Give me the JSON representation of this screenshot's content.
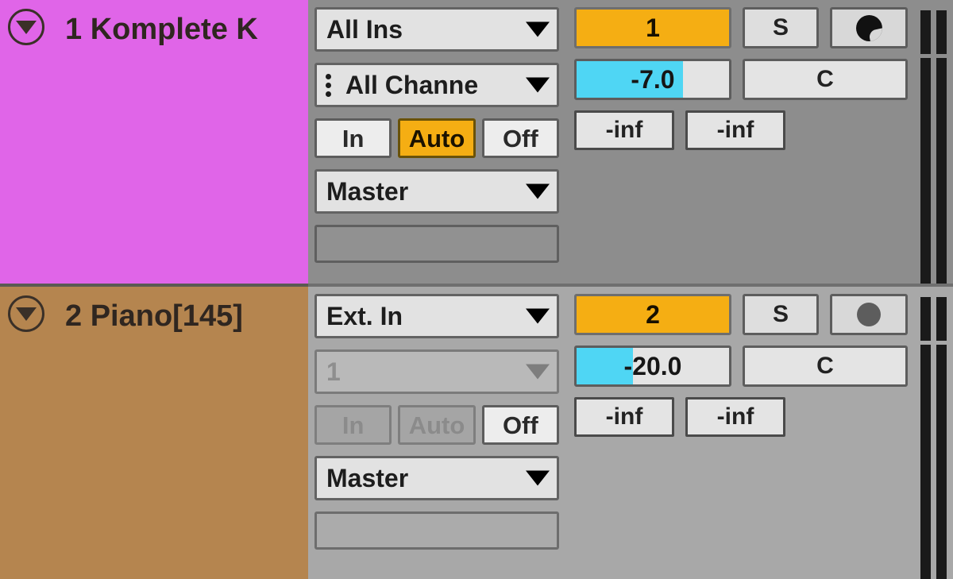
{
  "app": "ableton-live-mixer",
  "tracks": [
    {
      "name": "1 Komplete K",
      "color": "#e065e8",
      "fold_icon": "chevron-down-circle-icon",
      "input_type": "All Ins",
      "input_channel": "All Channe",
      "input_channel_icon": "midi-channel-dots-icon",
      "monitor": {
        "in": "In",
        "auto": "Auto",
        "off": "Off",
        "selected": "Auto"
      },
      "output": "Master",
      "device_slot": "",
      "activator": "1",
      "solo": "S",
      "arm_icon": "midi-arm-icon",
      "volume": "-7.0",
      "volume_fill_percent": 70,
      "pan": "C",
      "sends": [
        "-inf",
        "-inf"
      ],
      "meter_channels": 2,
      "panel_shade": "dark",
      "disabled_io": false
    },
    {
      "name": "2 Piano[145]",
      "color": "#b5854f",
      "fold_icon": "chevron-down-circle-icon",
      "input_type": "Ext. In",
      "input_channel": "1",
      "input_channel_icon": "",
      "monitor": {
        "in": "In",
        "auto": "Auto",
        "off": "Off",
        "selected": "Off"
      },
      "output": "Master",
      "device_slot": "",
      "activator": "2",
      "solo": "S",
      "arm_icon": "audio-arm-dot-icon",
      "volume": "-20.0",
      "volume_fill_percent": 37,
      "pan": "C",
      "sends": [
        "-inf",
        "-inf"
      ],
      "meter_channels": 2,
      "panel_shade": "light",
      "disabled_io": true
    }
  ],
  "colors": {
    "track1": "#e065e8",
    "track2": "#b5854f",
    "activator_orange": "#f5ae13",
    "volume_cyan": "#4fd6f4",
    "panel_dark": "#8d8d8d",
    "panel_light": "#a8a8a8"
  }
}
